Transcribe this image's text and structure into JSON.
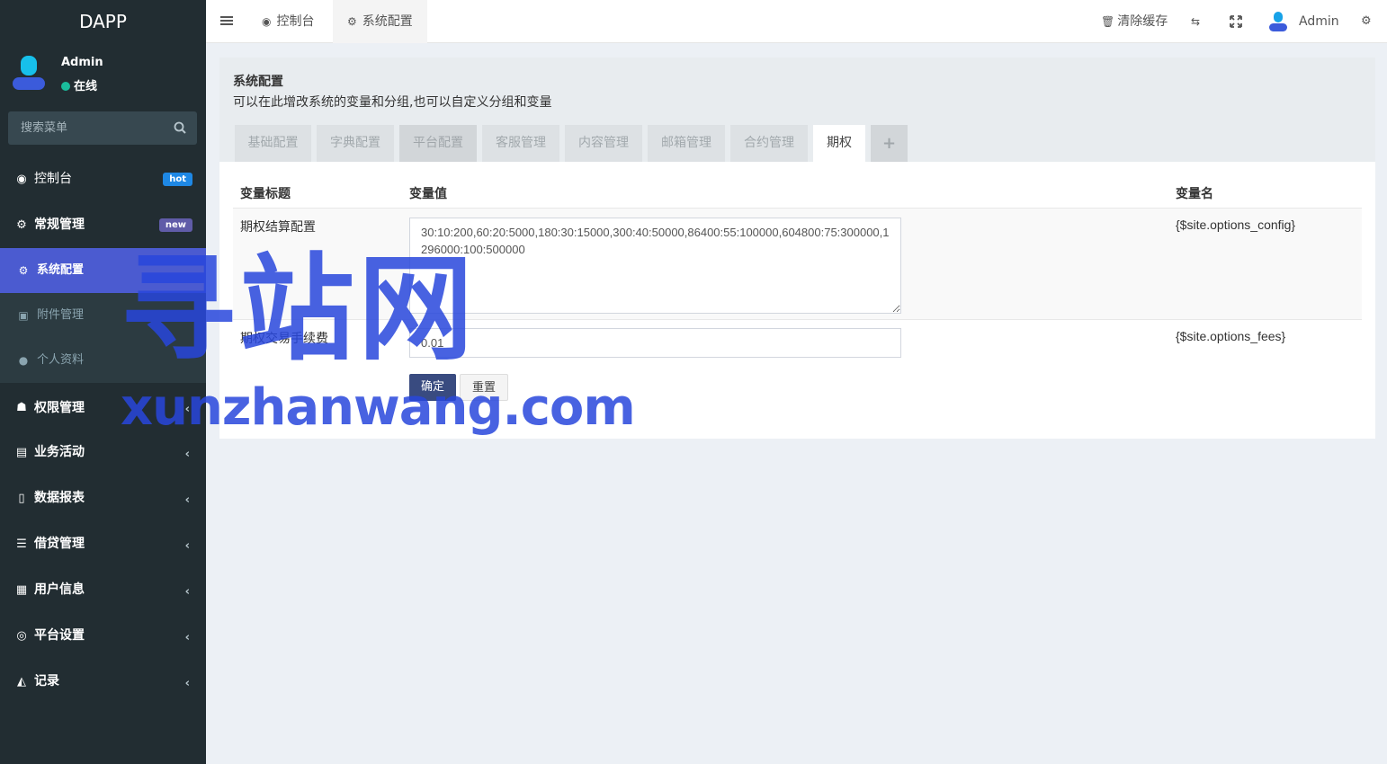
{
  "app": {
    "brand": "DAPP"
  },
  "user": {
    "name": "Admin",
    "status": "在线"
  },
  "search": {
    "placeholder": "搜索菜单"
  },
  "menu": {
    "dashboard": {
      "label": "控制台",
      "badge": "hot"
    },
    "general": {
      "label": "常规管理",
      "badge": "new"
    },
    "sub": [
      "系统配置",
      "附件管理",
      "个人资料"
    ],
    "items": [
      "权限管理",
      "业务活动",
      "数据报表",
      "借贷管理",
      "用户信息",
      "平台设置",
      "记录"
    ]
  },
  "header": {
    "tabs": [
      "控制台",
      "系统配置"
    ],
    "clear_cache": "清除缓存",
    "admin": "Admin"
  },
  "panel": {
    "title": "系统配置",
    "desc": "可以在此增改系统的变量和分组,也可以自定义分组和变量",
    "tabs": [
      "基础配置",
      "字典配置",
      "平台配置",
      "客服管理",
      "内容管理",
      "邮箱管理",
      "合约管理",
      "期权",
      "+"
    ]
  },
  "table": {
    "headers": [
      "变量标题",
      "变量值",
      "变量名"
    ],
    "rows": [
      {
        "title": "期权结算配置",
        "value": "30:10:200,60:20:5000,180:30:15000,300:40:50000,86400:55:100000,604800:75:300000,1296000:100:500000",
        "var": "{$site.options_config}"
      },
      {
        "title": "期权交易手续费",
        "value": "0.01",
        "var": "{$site.options_fees}"
      }
    ]
  },
  "buttons": {
    "ok": "确定",
    "reset": "重置"
  },
  "watermark": {
    "cn": "寻站网",
    "en": "xunzhanwang.com"
  },
  "colors": {
    "sidebar": "#222d32",
    "active": "#4b5bd0",
    "primary": "#394b80"
  }
}
